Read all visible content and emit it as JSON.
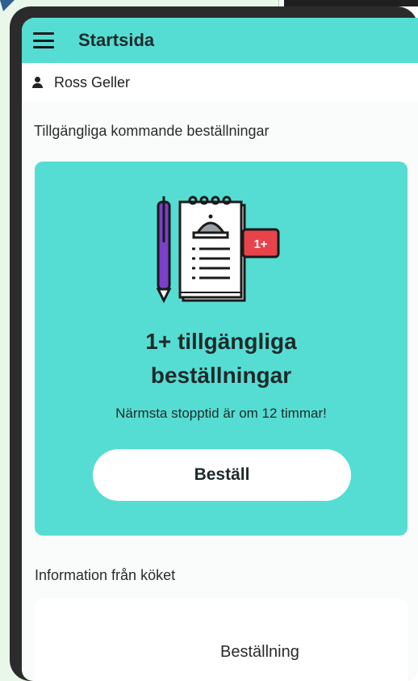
{
  "app_bar": {
    "title": "Startsida",
    "menu_icon": "hamburger-menu-icon"
  },
  "user": {
    "name": "Ross Geller",
    "icon": "person-icon"
  },
  "upcoming": {
    "section_title": "Tillgängliga kommande beställningar",
    "badge": "1+",
    "heading_line1": "1+ tillgängliga",
    "heading_line2": "beställningar",
    "subtitle": "Närmsta stopptid är om 12 timmar!",
    "button_label": "Beställ",
    "card_color": "#56ddd3"
  },
  "kitchen_info": {
    "section_title": "Information från köket",
    "item_label": "Beställning"
  },
  "colors": {
    "accent": "#56ddd3",
    "badge": "#e8434a",
    "pen": "#7b3fc9"
  }
}
